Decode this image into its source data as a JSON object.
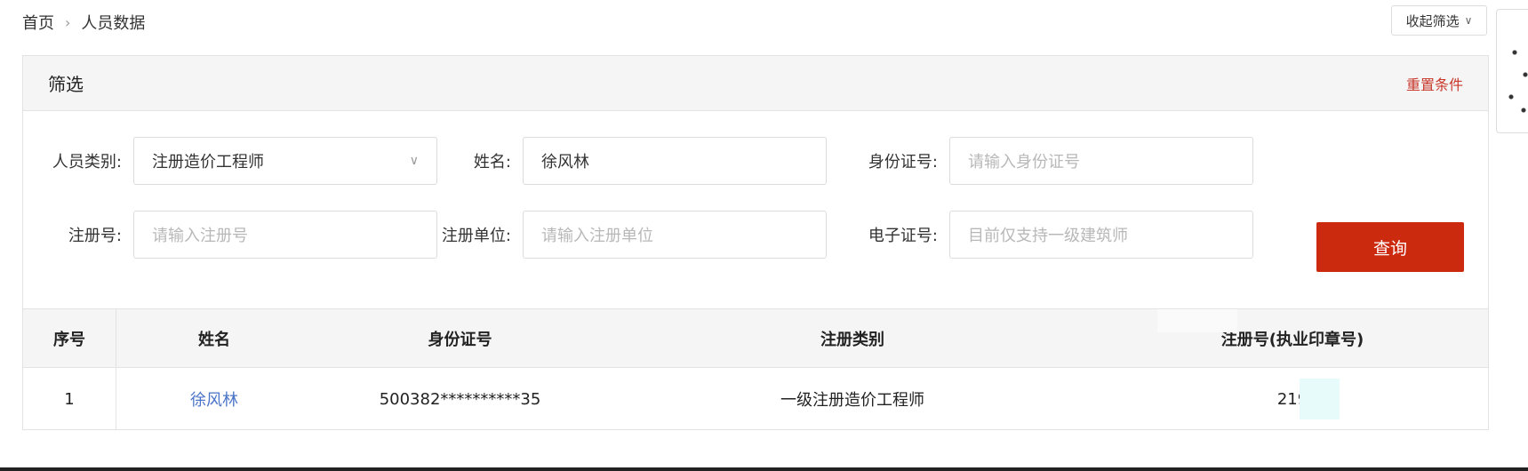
{
  "breadcrumb": {
    "home": "首页",
    "current": "人员数据"
  },
  "collapse_filter": {
    "label": "收起筛选"
  },
  "filter": {
    "title": "筛选",
    "reset_label": "重置条件",
    "fields": {
      "person_type": {
        "label": "人员类别:",
        "value": "注册造价工程师"
      },
      "name": {
        "label": "姓名:",
        "value": "徐风林"
      },
      "id_number": {
        "label": "身份证号:",
        "placeholder": "请输入身份证号"
      },
      "reg_number": {
        "label": "注册号:",
        "placeholder": "请输入注册号"
      },
      "reg_unit": {
        "label": "注册单位:",
        "placeholder": "请输入注册单位"
      },
      "e_cert": {
        "label": "电子证号:",
        "placeholder": "目前仅支持一级建筑师"
      }
    },
    "search_label": "查询"
  },
  "table": {
    "columns": [
      "序号",
      "姓名",
      "身份证号",
      "注册类别",
      "注册号(执业印章号)"
    ],
    "rows": [
      {
        "index": "1",
        "name": "徐风林",
        "id_number": "500382**********35",
        "reg_type": "一级注册造价工程师",
        "reg_number": "219"
      }
    ]
  },
  "colors": {
    "accent": "#cb2a0f",
    "link": "#4a74c7",
    "reset": "#c8372a"
  },
  "icons": [
    "chevron-right-icon",
    "chevron-down-icon"
  ]
}
